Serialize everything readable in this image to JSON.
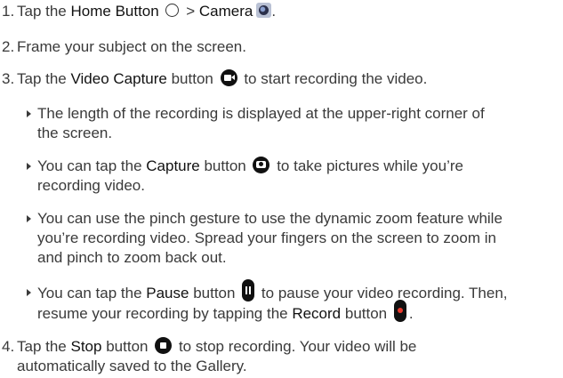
{
  "steps": {
    "s1": {
      "num": "1.",
      "a": "Tap the ",
      "b1": "Home Button",
      "c": " > ",
      "b2": "Camera",
      "d": "."
    },
    "s2": {
      "num": "2.",
      "text": "Frame your subject on the screen."
    },
    "s3": {
      "num": "3.",
      "a": "Tap the ",
      "b": "Video Capture",
      "c": " button",
      "d": " to start recording the video."
    },
    "bullets": {
      "b1": {
        "l1": "The length of the recording is displayed at the upper-right corner of",
        "l2": "the screen."
      },
      "b2": {
        "l1a": "You can tap the ",
        "l1b": "Capture",
        "l1c": " button",
        "l1d": " to take pictures while you’re",
        "l2": "recording video."
      },
      "b3": {
        "l1": "You can use the pinch gesture to use the dynamic zoom feature while",
        "l2": "you’re recording video. Spread your fingers on the screen to zoom in",
        "l3": "and pinch to zoom back out."
      },
      "b4": {
        "l1a": "You can tap the ",
        "l1b": "Pause",
        "l1c": " button",
        "l1d": " to pause your video recording. Then,",
        "l2a": "resume your recording by tapping the ",
        "l2b": "Record",
        "l2c": " button",
        "l2d": "."
      }
    },
    "s4": {
      "num": "4.",
      "a": "Tap the ",
      "b": "Stop",
      "c": " button",
      "d": " to stop recording. Your video will be",
      "l2": "automatically saved to the Gallery."
    }
  },
  "icons": {
    "home": "home-circle-icon",
    "camera": "camera-app-icon",
    "video": "video-capture-icon",
    "capture": "photo-capture-icon",
    "pause": "pause-icon",
    "record": "record-icon",
    "stop": "stop-icon"
  },
  "colors": {
    "text": "#3a3a3a",
    "bold": "#111111",
    "record_dot": "#e8392c",
    "icon_fill": "#111111"
  }
}
